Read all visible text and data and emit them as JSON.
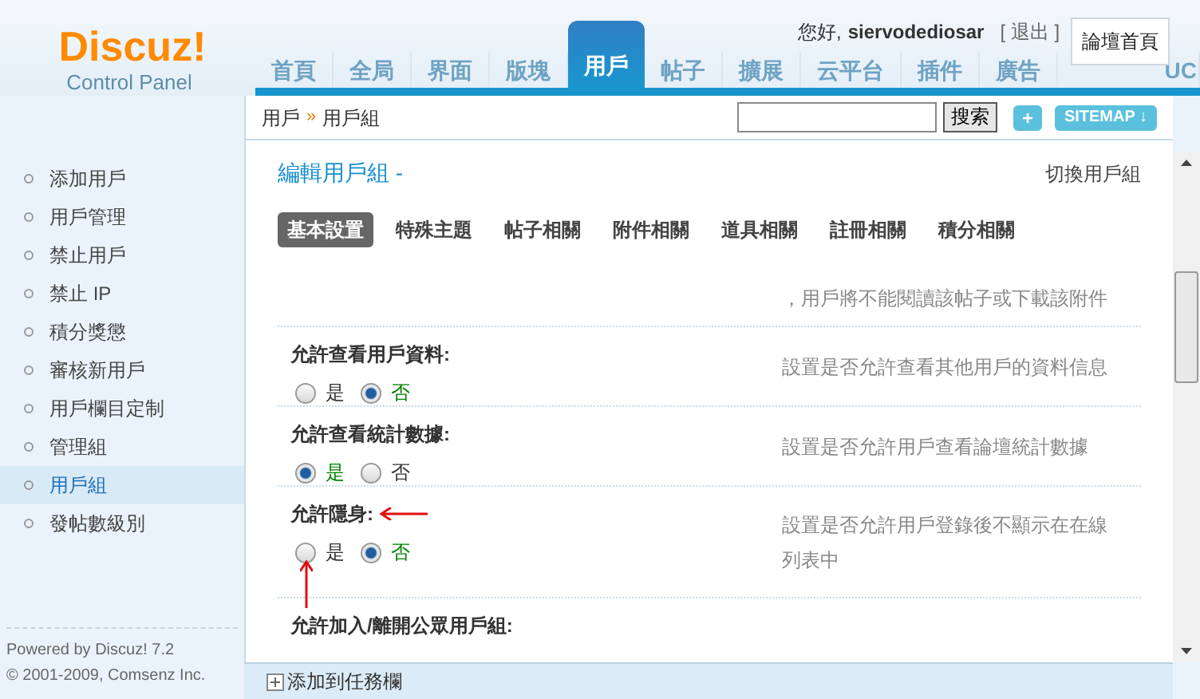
{
  "logo": {
    "brand": "Discuz!",
    "subtitle": "Control Panel"
  },
  "nav": [
    {
      "label": "首頁",
      "selected": false
    },
    {
      "label": "全局",
      "selected": false
    },
    {
      "label": "界面",
      "selected": false
    },
    {
      "label": "版塊",
      "selected": false
    },
    {
      "label": "用戶",
      "selected": true
    },
    {
      "label": "帖子",
      "selected": false
    },
    {
      "label": "擴展",
      "selected": false
    },
    {
      "label": "云平台",
      "selected": false
    },
    {
      "label": "插件",
      "selected": false
    },
    {
      "label": "廣告",
      "selected": false
    },
    {
      "label": "UC",
      "selected": false
    }
  ],
  "user": {
    "greeting": "您好,",
    "name": "siervodediosar",
    "logout": "[ 退出 ]",
    "forum_home": "論壇首頁"
  },
  "breadcrumb": [
    "用戶",
    "»",
    "用戶組"
  ],
  "search": {
    "button": "搜索"
  },
  "toolbar": {
    "add": "+",
    "sitemap": "SITEMAP ↓"
  },
  "sidebar": {
    "items": [
      {
        "label": "添加用戶",
        "selected": false
      },
      {
        "label": "用戶管理",
        "selected": false
      },
      {
        "label": "禁止用戶",
        "selected": false
      },
      {
        "label": "禁止 IP",
        "selected": false
      },
      {
        "label": "積分獎懲",
        "selected": false
      },
      {
        "label": "審核新用戶",
        "selected": false
      },
      {
        "label": "用戶欄目定制",
        "selected": false
      },
      {
        "label": "管理組",
        "selected": false
      },
      {
        "label": "用戶組",
        "selected": true
      },
      {
        "label": "發帖數級別",
        "selected": false
      }
    ],
    "footer": [
      "Powered by Discuz! 7.2",
      "© 2001-2009, Comsenz Inc."
    ]
  },
  "panel": {
    "title": "編輯用戶組 -",
    "switch": "切換用戶組",
    "tabs": [
      {
        "label": "基本設置",
        "selected": true
      },
      {
        "label": "特殊主題",
        "selected": false
      },
      {
        "label": "帖子相關",
        "selected": false
      },
      {
        "label": "附件相關",
        "selected": false
      },
      {
        "label": "道具相關",
        "selected": false
      },
      {
        "label": "註冊相關",
        "selected": false
      },
      {
        "label": "積分相關",
        "selected": false
      }
    ],
    "settings": [
      {
        "kind": "note",
        "description": "，用戶將不能閱讀該帖子或下載該附件"
      },
      {
        "kind": "radio",
        "label": "允許查看用戶資料:",
        "options": [
          {
            "label": "是",
            "selected": false
          },
          {
            "label": "否",
            "selected": true
          }
        ],
        "description": "設置是否允許查看其他用戶的資料信息"
      },
      {
        "kind": "radio",
        "label": "允許查看統計數據:",
        "options": [
          {
            "label": "是",
            "selected": true
          },
          {
            "label": "否",
            "selected": false
          }
        ],
        "description": "設置是否允許用戶查看論壇統計數據"
      },
      {
        "kind": "radio",
        "label": "允許隱身:",
        "options": [
          {
            "label": "是",
            "selected": false
          },
          {
            "label": "否",
            "selected": true
          }
        ],
        "description": "設置是否允許用戶登錄後不顯示在在線列表中",
        "arrows": true
      },
      {
        "kind": "radio",
        "label": "允許加入/離開公眾用戶組:"
      }
    ]
  },
  "taskbar": {
    "add": "添加到任務欄"
  }
}
